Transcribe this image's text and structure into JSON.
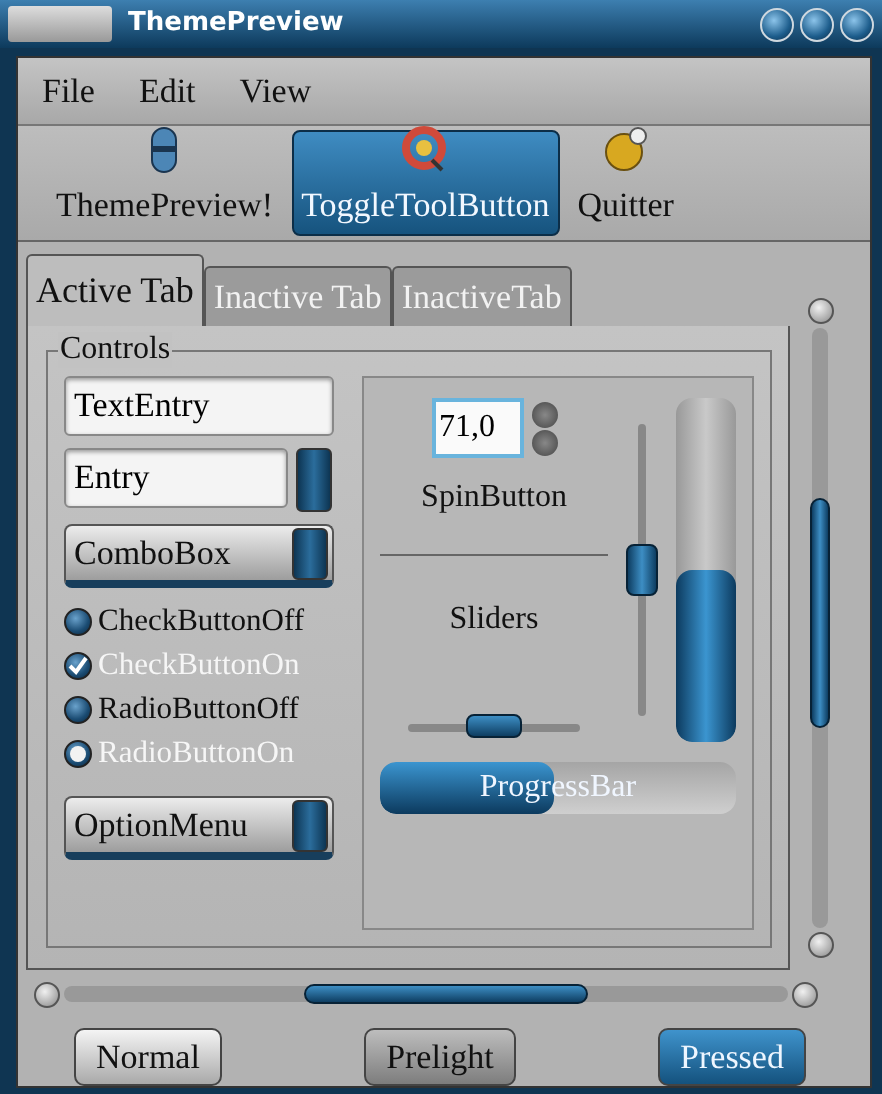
{
  "window": {
    "title": "ThemePreview"
  },
  "menu": [
    {
      "label": "File"
    },
    {
      "label": "Edit"
    },
    {
      "label": "View"
    }
  ],
  "toolbar": [
    {
      "label": "ThemePreview!",
      "selected": false,
      "kind": "capsule"
    },
    {
      "label": "ToggleToolButton",
      "selected": true,
      "kind": "swirl"
    },
    {
      "label": "Quitter",
      "selected": false,
      "kind": "sphere"
    }
  ],
  "tabs": [
    {
      "label": "Active Tab",
      "selected": true
    },
    {
      "label": "Inactive Tab",
      "selected": false
    },
    {
      "label": "InactiveTab",
      "selected": false
    }
  ],
  "controls": {
    "title": "Controls",
    "text_entry": {
      "value": "TextEntry"
    },
    "entry": {
      "value": "Entry"
    },
    "combo": {
      "value": "ComboBox"
    },
    "toggles": [
      {
        "kind": "check",
        "label": "CheckButtonOff",
        "checked": false
      },
      {
        "kind": "check",
        "label": "CheckButtonOn",
        "checked": true
      },
      {
        "kind": "radio",
        "label": "RadioButtonOff",
        "checked": false
      },
      {
        "kind": "radio",
        "label": "RadioButtonOn",
        "checked": true
      }
    ],
    "option_menu": {
      "value": "OptionMenu"
    }
  },
  "spin": {
    "value": "71,0",
    "label": "SpinButton"
  },
  "sliders": {
    "label": "Sliders",
    "vertical": {
      "level": 0.5
    },
    "horizontal": {
      "level": 0.5
    },
    "meter": {
      "level": 0.5
    }
  },
  "progress": {
    "label": "ProgressBar",
    "level": 0.49
  },
  "buttons": [
    {
      "label": "Normal",
      "kind": "normal"
    },
    {
      "label": "Prelight",
      "kind": "prelight"
    },
    {
      "label": "Pressed",
      "kind": "pressed"
    }
  ]
}
